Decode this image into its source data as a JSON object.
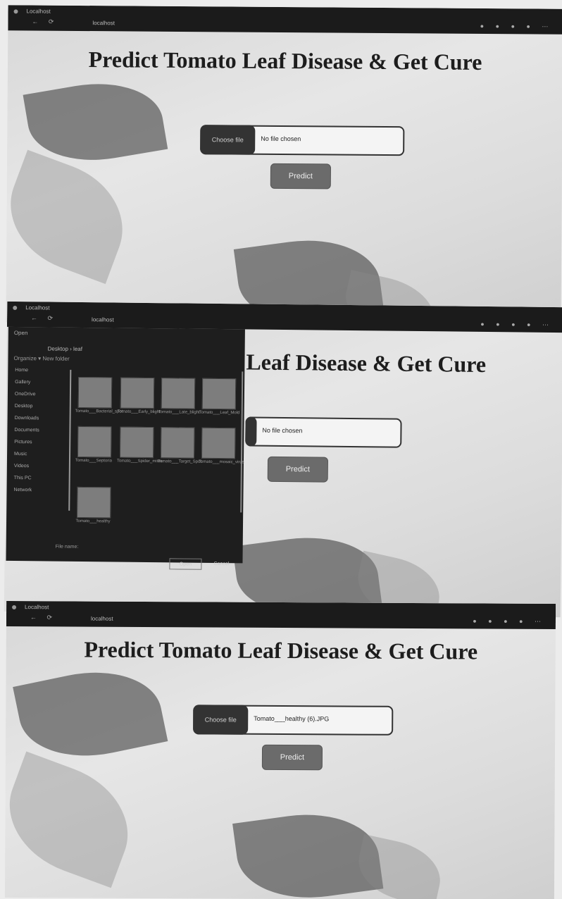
{
  "app": {
    "title": "Predict Tomato Leaf Disease & Get Cure",
    "title_partial": "Leaf Disease & Get Cure",
    "choose_file_label": "Choose file",
    "predict_label": "Predict",
    "tab_label": "Localhost",
    "url_label": "localhost"
  },
  "shots": [
    {
      "file_status": "No file chosen"
    },
    {
      "file_status": "No file chosen"
    },
    {
      "file_status": "Tomato___healthy (6).JPG"
    }
  ],
  "dialog": {
    "title": "Open",
    "path": "Desktop  ›  leaf",
    "toolbar": "Organize ▾   New folder",
    "sidebar": [
      "Home",
      "Gallery",
      "OneDrive",
      "Desktop",
      "Downloads",
      "Documents",
      "Pictures",
      "Music",
      "Videos",
      "This PC",
      "Network"
    ],
    "files": [
      "Tomato___Bacterial_spot",
      "Tomato___Early_blight",
      "Tomato___Late_blight",
      "Tomato___Leaf_Mold",
      "Tomato___Septoria",
      "Tomato___Spider_mites",
      "Tomato___Target_Spot",
      "Tomato___mosaic_virus",
      "Tomato___healthy"
    ],
    "file_name_label": "File name:",
    "open_label": "Open",
    "cancel_label": "Cancel"
  },
  "colors": {
    "accent": "#333333",
    "predict": "#6b6b6b",
    "title": "#1d1d1d"
  }
}
